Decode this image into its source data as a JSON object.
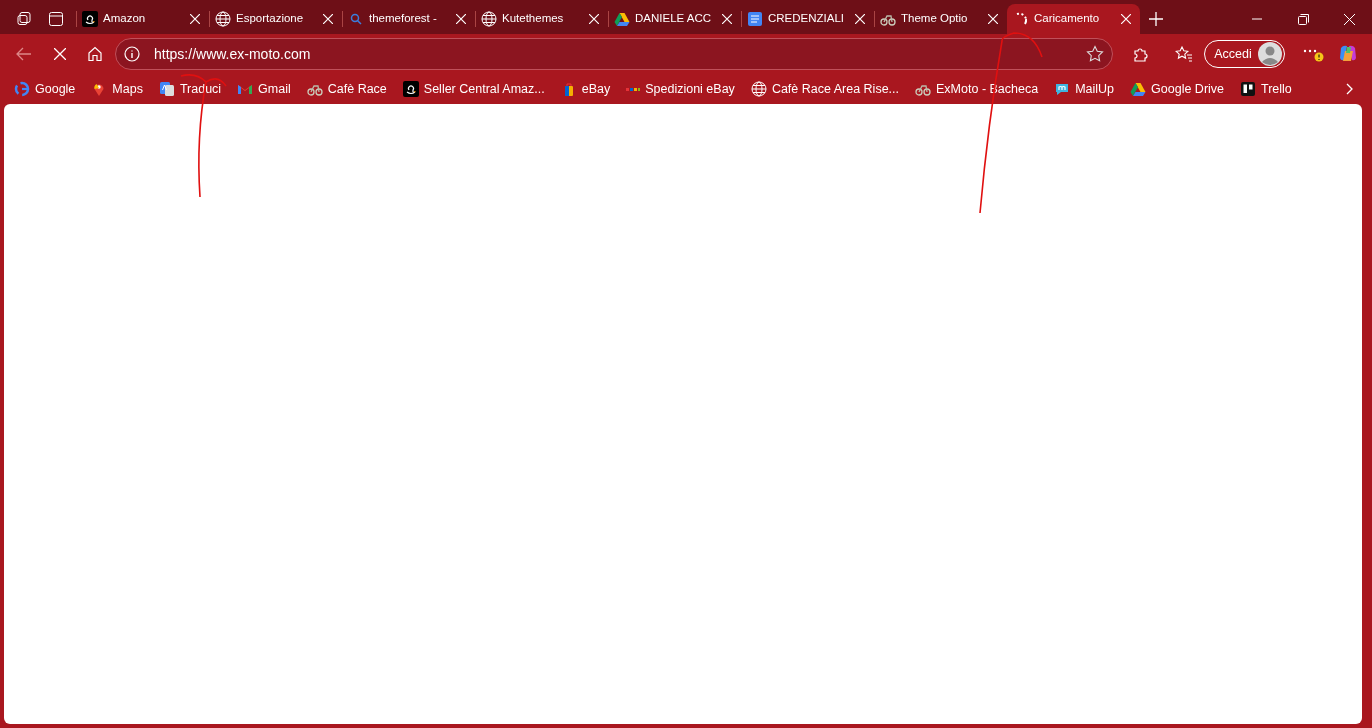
{
  "tabs": [
    {
      "label": "Amazon",
      "selected": false
    },
    {
      "label": "Esportazione",
      "selected": false
    },
    {
      "label": "themeforest -",
      "selected": false
    },
    {
      "label": "Kutethemes",
      "selected": false
    },
    {
      "label": "DANIELE ACC",
      "selected": false
    },
    {
      "label": "CREDENZIALI",
      "selected": false
    },
    {
      "label": "Theme Optio",
      "selected": false
    },
    {
      "label": "Caricamento",
      "selected": true
    }
  ],
  "address": {
    "value": "https://www.ex-moto.com"
  },
  "profile": {
    "label": "Accedi"
  },
  "bookmarks": [
    {
      "label": "Google"
    },
    {
      "label": "Maps"
    },
    {
      "label": "Traduci"
    },
    {
      "label": "Gmail"
    },
    {
      "label": "Cafè Race"
    },
    {
      "label": "Seller Central Amaz..."
    },
    {
      "label": "eBay"
    },
    {
      "label": "Spedizioni eBay"
    },
    {
      "label": "Cafè Race Area Rise..."
    },
    {
      "label": "ExMoto - Bacheca"
    },
    {
      "label": "MailUp"
    },
    {
      "label": "Google Drive"
    },
    {
      "label": "Trello"
    }
  ]
}
